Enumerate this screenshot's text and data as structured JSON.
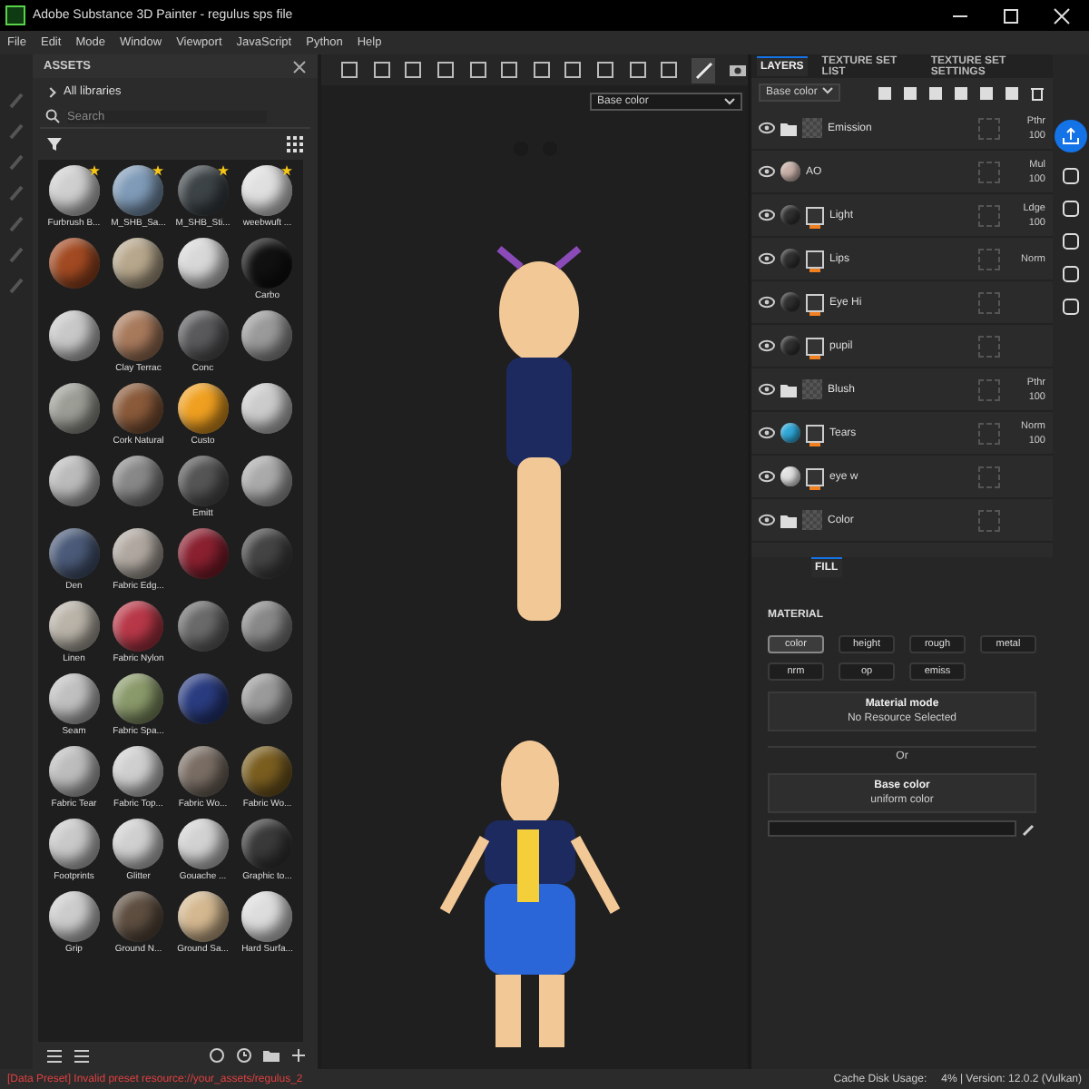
{
  "window": {
    "title": "Adobe Substance 3D Painter - regulus sps file"
  },
  "menu": [
    "File",
    "Edit",
    "Mode",
    "Window",
    "Viewport",
    "JavaScript",
    "Python",
    "Help"
  ],
  "assets": {
    "title": "ASSETS",
    "library": "All libraries",
    "search_placeholder": "Search",
    "items": [
      {
        "label": "Furbrush B...",
        "color": "#cfcfcf",
        "favorite": true
      },
      {
        "label": "M_SHB_Sa...",
        "color": "#7f9bb8",
        "favorite": true
      },
      {
        "label": "M_SHB_Sti...",
        "color": "#3d4448",
        "favorite": true
      },
      {
        "label": "weebwuft ...",
        "color": "#e0e0e0",
        "favorite": true
      },
      {
        "color": "#a24a22",
        "favorite": false
      },
      {
        "color": "#b7a78c",
        "favorite": false
      },
      {
        "color": "#d8d8d8",
        "favorite": false
      },
      {
        "label": "Carbo",
        "color": "#111111",
        "favorite": false
      },
      {
        "color": "#c8c8c8",
        "favorite": false
      },
      {
        "label": "Clay Terrac",
        "color": "#a87a5c",
        "favorite": false
      },
      {
        "label": "Conc",
        "color": "#5a5a5c",
        "favorite": false
      },
      {
        "color": "#9a9a9a",
        "favorite": false
      },
      {
        "color": "#9c9e96",
        "favorite": false
      },
      {
        "label": "Cork Natural",
        "color": "#8a5a3a",
        "favorite": false
      },
      {
        "label": "Custo",
        "color": "#f0a020",
        "favorite": false
      },
      {
        "color": "#cccccc",
        "favorite": false
      },
      {
        "color": "#bbbbbb",
        "favorite": false
      },
      {
        "color": "#888888",
        "favorite": false
      },
      {
        "label": "Emitt",
        "color": "#555555",
        "favorite": false
      },
      {
        "color": "#aaaaaa",
        "favorite": false
      },
      {
        "label": "Den",
        "color": "#4a5a78",
        "favorite": false
      },
      {
        "label": "Fabric Edg...",
        "color": "#b0a8a0",
        "favorite": false
      },
      {
        "color": "#8a2030",
        "favorite": false
      },
      {
        "color": "#444444",
        "favorite": false
      },
      {
        "label": "Linen",
        "color": "#b9b3a8",
        "favorite": false
      },
      {
        "label": "Fabric Nylon",
        "color": "#b83848",
        "favorite": false
      },
      {
        "color": "#6a6a6a",
        "favorite": false
      },
      {
        "color": "#888888",
        "favorite": false
      },
      {
        "label": "Seam",
        "color": "#c0c0c0",
        "favorite": false
      },
      {
        "label": "Fabric Spa...",
        "color": "#8a9a6a",
        "favorite": false
      },
      {
        "color": "#2a3c80",
        "favorite": false
      },
      {
        "color": "#9a9a9a",
        "favorite": false
      },
      {
        "label": "Fabric Tear",
        "color": "#bdbdbd",
        "favorite": false
      },
      {
        "label": "Fabric Top...",
        "color": "#cfcfcf",
        "favorite": false
      },
      {
        "label": "Fabric Wo...",
        "color": "#7a6e64",
        "favorite": false
      },
      {
        "label": "Fabric Wo...",
        "color": "#7a5e20",
        "favorite": false
      },
      {
        "label": "Footprints",
        "color": "#c9c9c9",
        "favorite": false
      },
      {
        "label": "Glitter",
        "color": "#d0d0d0",
        "favorite": false
      },
      {
        "label": "Gouache ...",
        "color": "#d2d2d2",
        "favorite": false
      },
      {
        "label": "Graphic to...",
        "color": "#3a3a3a",
        "favorite": false
      },
      {
        "label": "Grip",
        "color": "#cccccc",
        "favorite": false
      },
      {
        "label": "Ground N...",
        "color": "#5e4e40",
        "favorite": false
      },
      {
        "label": "Ground Sa...",
        "color": "#d4b890",
        "favorite": false
      },
      {
        "label": "Hard Surfa...",
        "color": "#dddddd",
        "favorite": false
      }
    ]
  },
  "viewport": {
    "channel": "Base color"
  },
  "panel_tabs": [
    {
      "label": "LAYERS",
      "selected": true
    },
    {
      "label": "TEXTURE SET LIST",
      "selected": false
    },
    {
      "label": "TEXTURE SET SETTINGS",
      "selected": false
    }
  ],
  "layer_channel": "Base color",
  "layers": [
    {
      "kind": "folder",
      "name": "Emission",
      "blend": "Pthr",
      "opacity": "100"
    },
    {
      "kind": "paint",
      "name": "AO",
      "blend": "Mul",
      "opacity": "100",
      "color": "#c8b0a8"
    },
    {
      "kind": "fill",
      "name": "Light",
      "blend": "Ldge",
      "opacity": "100",
      "color": "#303030"
    },
    {
      "kind": "fill",
      "name": "Lips",
      "blend": "Norm",
      "color": "#303030"
    },
    {
      "kind": "fill",
      "name": "Eye Hi",
      "color": "#303030"
    },
    {
      "kind": "fill",
      "name": "pupil",
      "color": "#303030"
    },
    {
      "kind": "folder",
      "name": "Blush",
      "blend": "Pthr",
      "opacity": "100"
    },
    {
      "kind": "fill",
      "name": "Tears",
      "blend": "Norm",
      "opacity": "100",
      "color": "#30a8d8"
    },
    {
      "kind": "fill",
      "name": "eye w",
      "color": "#e0e0e0"
    },
    {
      "kind": "folder",
      "name": "Color"
    }
  ],
  "properties": {
    "tab": "FILL",
    "section": "MATERIAL",
    "channels": [
      {
        "label": "color",
        "selected": true
      },
      {
        "label": "height",
        "selected": false
      },
      {
        "label": "rough",
        "selected": false
      },
      {
        "label": "metal",
        "selected": false
      },
      {
        "label": "nrm",
        "selected": false
      },
      {
        "label": "op",
        "selected": false
      },
      {
        "label": "emiss",
        "selected": false
      }
    ],
    "material_mode": {
      "title": "Material mode",
      "value": "No Resource Selected"
    },
    "or": "Or",
    "base_color": {
      "title": "Base color",
      "value": "uniform color"
    }
  },
  "status_bar": {
    "message": "[Data Preset] Invalid preset resource://your_assets/regulus_2",
    "cache_label": "Cache Disk Usage:",
    "version": "4% | Version: 12.0.2 (Vulkan)"
  }
}
